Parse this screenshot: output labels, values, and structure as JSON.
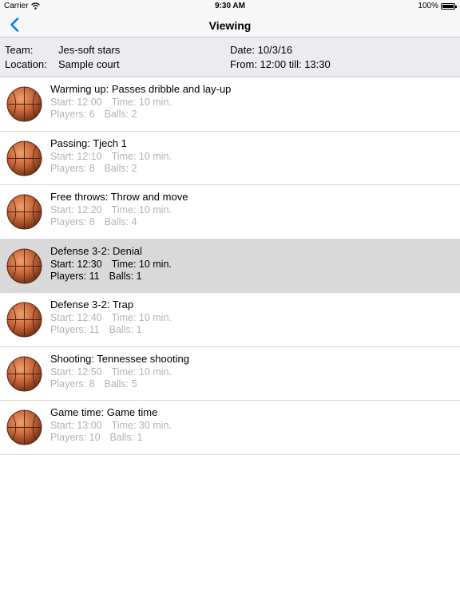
{
  "status_bar": {
    "carrier": "Carrier",
    "time": "9:30 AM",
    "battery": "100%"
  },
  "nav": {
    "title": "Viewing",
    "back_icon": "chevron-left-icon"
  },
  "info": {
    "team_label": "Team:",
    "team_value": "Jes-soft stars",
    "location_label": "Location:",
    "location_value": "Sample court",
    "date_text": "Date: 10/3/16",
    "time_text": "From: 12:00 till: 13:30"
  },
  "drills": [
    {
      "title": "Warming up: Passes dribble and lay-up",
      "start": "Start: 12:00",
      "time": "Time: 10 min.",
      "players": "Players: 6",
      "balls": "Balls: 2"
    },
    {
      "title": "Passing: Tjech 1",
      "start": "Start: 12:10",
      "time": "Time: 10 min.",
      "players": "Players: 8",
      "balls": "Balls: 2"
    },
    {
      "title": "Free throws: Throw and move",
      "start": "Start: 12:20",
      "time": "Time: 10 min.",
      "players": "Players: 8",
      "balls": "Balls: 4"
    },
    {
      "title": "Defense 3-2: Denial",
      "start": "Start: 12:30",
      "time": "Time: 10 min.",
      "players": "Players: 11",
      "balls": "Balls: 1"
    },
    {
      "title": "Defense 3-2: Trap",
      "start": "Start: 12:40",
      "time": "Time: 10 min.",
      "players": "Players: 11",
      "balls": "Balls: 1"
    },
    {
      "title": "Shooting: Tennessee shooting",
      "start": "Start: 12:50",
      "time": "Time: 10 min.",
      "players": "Players: 8",
      "balls": "Balls: 5"
    },
    {
      "title": "Game time: Game time",
      "start": "Start: 13:00",
      "time": "Time: 30 min.",
      "players": "Players: 10",
      "balls": "Balls: 1"
    }
  ],
  "colors": {
    "accent": "#007aff",
    "ball": "#c8683a",
    "selected_row": "#d9d9d9"
  }
}
